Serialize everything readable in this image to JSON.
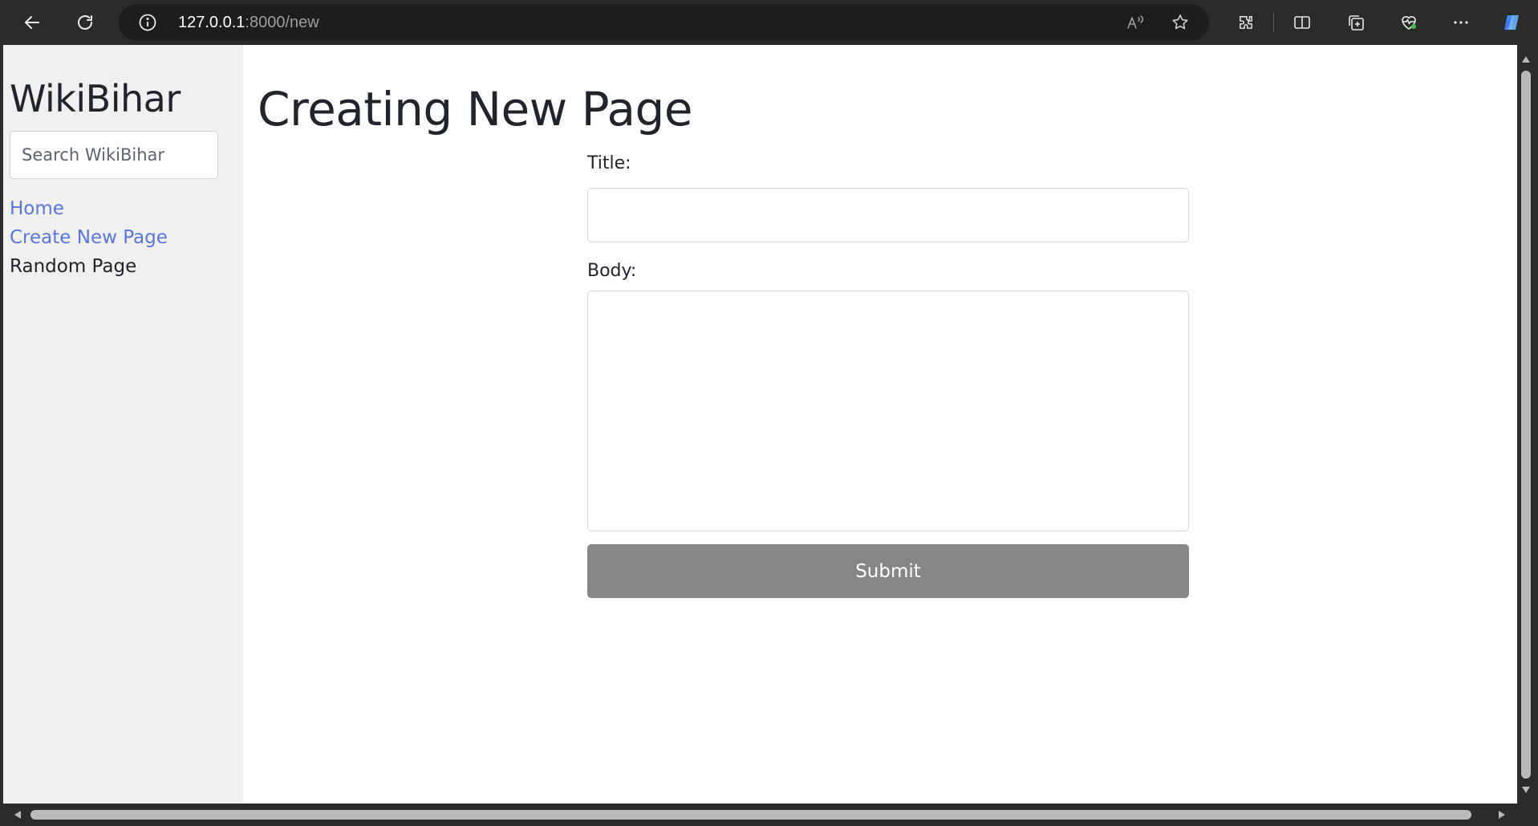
{
  "browser": {
    "url_host": "127.0.0.1",
    "url_rest": ":8000/new",
    "icons": [
      "back-arrow-icon",
      "refresh-icon",
      "site-info-icon",
      "read-aloud-icon",
      "favorite-star-icon",
      "extensions-icon",
      "split-screen-icon",
      "collections-icon",
      "browser-essentials-icon",
      "more-options-icon",
      "copilot-icon"
    ]
  },
  "sidebar": {
    "brand": "WikiBihar",
    "search_placeholder": "Search WikiBihar",
    "nav": [
      {
        "label": "Home",
        "style": "link"
      },
      {
        "label": "Create New Page",
        "style": "link"
      },
      {
        "label": "Random Page",
        "style": "plain"
      }
    ]
  },
  "main": {
    "heading": "Creating New Page",
    "form": {
      "title_label": "Title:",
      "title_value": "",
      "body_label": "Body:",
      "body_value": "",
      "submit_label": "Submit"
    }
  },
  "colors": {
    "link": "#5b74e0",
    "sidebar_bg": "#f0f0f0",
    "submit_bg": "#868686",
    "chrome_bg": "#2b2b2b"
  }
}
